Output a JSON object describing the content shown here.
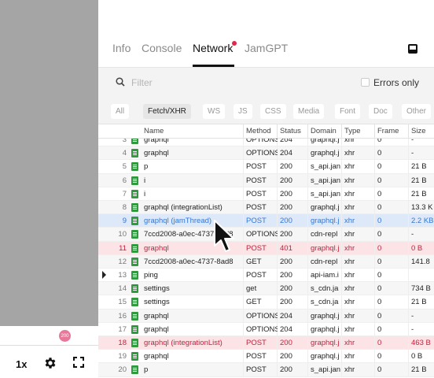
{
  "player": {
    "speed": "1x",
    "badge": "200"
  },
  "devtools": {
    "tabs": [
      {
        "label": "Info",
        "active": false
      },
      {
        "label": "Console",
        "active": false
      },
      {
        "label": "Network",
        "active": true
      },
      {
        "label": "JamGPT",
        "active": false
      }
    ],
    "filter": {
      "placeholder": "Filter",
      "errors_only_label": "Errors only"
    },
    "type_filters": [
      "All",
      "Fetch/XHR",
      "WS",
      "JS",
      "CSS",
      "Media",
      "Font",
      "Doc",
      "Other"
    ],
    "selected_type": "Fetch/XHR",
    "columns": [
      "Name",
      "Method",
      "Status",
      "Domain",
      "Type",
      "Frame",
      "Size"
    ],
    "rows": [
      {
        "num": "3",
        "name": "graphql",
        "method": "OPTIONS",
        "status": "204",
        "domain": "graphql.j",
        "type": "xhr",
        "frame": "0",
        "size": "-",
        "state": "normal"
      },
      {
        "num": "4",
        "name": "graphql",
        "method": "OPTIONS",
        "status": "204",
        "domain": "graphql.j",
        "type": "xhr",
        "frame": "0",
        "size": "-",
        "state": "normal"
      },
      {
        "num": "5",
        "name": "p",
        "method": "POST",
        "status": "200",
        "domain": "s_api.jan",
        "type": "xhr",
        "frame": "0",
        "size": "21 B",
        "state": "normal"
      },
      {
        "num": "6",
        "name": "i",
        "method": "POST",
        "status": "200",
        "domain": "s_api.jan",
        "type": "xhr",
        "frame": "0",
        "size": "21 B",
        "state": "normal"
      },
      {
        "num": "7",
        "name": "i",
        "method": "POST",
        "status": "200",
        "domain": "s_api.jan",
        "type": "xhr",
        "frame": "0",
        "size": "21 B",
        "state": "normal"
      },
      {
        "num": "8",
        "name": "graphql (integrationList)",
        "method": "POST",
        "status": "200",
        "domain": "graphql.j",
        "type": "xhr",
        "frame": "0",
        "size": "13.3 K",
        "state": "normal"
      },
      {
        "num": "9",
        "name": "graphql (jamThread)",
        "method": "POST",
        "status": "200",
        "domain": "graphql.j",
        "type": "xhr",
        "frame": "0",
        "size": "2.2 KB",
        "state": "selected"
      },
      {
        "num": "10",
        "name": "7ccd2008-a0ec-4737-8ad8",
        "method": "OPTIONS",
        "status": "200",
        "domain": "cdn-repl",
        "type": "xhr",
        "frame": "0",
        "size": "-",
        "state": "normal"
      },
      {
        "num": "11",
        "name": "graphql",
        "method": "POST",
        "status": "401",
        "domain": "graphql.j",
        "type": "xhr",
        "frame": "0",
        "size": "0 B",
        "state": "error"
      },
      {
        "num": "12",
        "name": "7ccd2008-a0ec-4737-8ad8",
        "method": "GET",
        "status": "200",
        "domain": "cdn-repl",
        "type": "xhr",
        "frame": "0",
        "size": "141.8",
        "state": "normal"
      },
      {
        "num": "13",
        "name": "ping",
        "method": "POST",
        "status": "200",
        "domain": "api-iam.i",
        "type": "xhr",
        "frame": "0",
        "size": "",
        "state": "current"
      },
      {
        "num": "14",
        "name": "settings",
        "method": "get",
        "status": "200",
        "domain": "s_cdn.ja",
        "type": "xhr",
        "frame": "0",
        "size": "734 B",
        "state": "normal"
      },
      {
        "num": "15",
        "name": "settings",
        "method": "GET",
        "status": "200",
        "domain": "s_cdn.ja",
        "type": "xhr",
        "frame": "0",
        "size": "21 B",
        "state": "normal"
      },
      {
        "num": "16",
        "name": "graphql",
        "method": "OPTIONS",
        "status": "204",
        "domain": "graphql.j",
        "type": "xhr",
        "frame": "0",
        "size": "-",
        "state": "normal"
      },
      {
        "num": "17",
        "name": "graphql",
        "method": "OPTIONS",
        "status": "204",
        "domain": "graphql.j",
        "type": "xhr",
        "frame": "0",
        "size": "-",
        "state": "normal"
      },
      {
        "num": "18",
        "name": "graphql (integrationList)",
        "method": "POST",
        "status": "200",
        "domain": "graphql.j",
        "type": "xhr",
        "frame": "0",
        "size": "463 B",
        "state": "error"
      },
      {
        "num": "19",
        "name": "graphql",
        "method": "POST",
        "status": "200",
        "domain": "graphql.j",
        "type": "xhr",
        "frame": "0",
        "size": "0 B",
        "state": "normal"
      },
      {
        "num": "20",
        "name": "p",
        "method": "POST",
        "status": "200",
        "domain": "s_api.jan",
        "type": "xhr",
        "frame": "0",
        "size": "21 B",
        "state": "normal"
      }
    ]
  },
  "colors": {
    "error_text": "#c8203c",
    "error_bg": "#fbe3e6",
    "selected_text": "#3478d6",
    "selected_bg": "#dde8f8",
    "file_icon": "#2e9c3c",
    "notification_dot": "#e0284a"
  }
}
